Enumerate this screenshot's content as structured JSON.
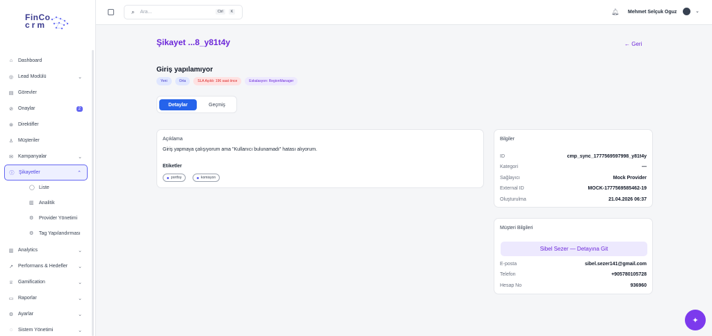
{
  "logo": {
    "line1": "FinCo",
    "line2": "crm"
  },
  "sidebar": {
    "items": [
      {
        "label": "Dashboard",
        "icon": "home-icon",
        "chevron": false
      },
      {
        "label": "Lead Modülü",
        "icon": "target-icon",
        "chevron": true
      },
      {
        "label": "Görevler",
        "icon": "clipboard-icon",
        "chevron": false
      },
      {
        "label": "Onaylar",
        "icon": "check-circle-icon",
        "badge": "2"
      },
      {
        "label": "Direktifler",
        "icon": "compass-icon",
        "chevron": false
      },
      {
        "label": "Müşteriler",
        "icon": "user-icon",
        "chevron": false
      },
      {
        "label": "Kampanyalar",
        "icon": "mail-icon",
        "chevron": true
      },
      {
        "label": "Şikayetler",
        "icon": "alert-circle-icon",
        "chevron": true,
        "active": true
      }
    ],
    "subitems": [
      {
        "label": "Liste",
        "icon": "circle-icon"
      },
      {
        "label": "Analitik",
        "icon": "bar-chart-icon"
      },
      {
        "label": "Provider Yönetimi",
        "icon": "settings-icon"
      },
      {
        "label": "Tag Yapılandırması",
        "icon": "settings-icon"
      }
    ],
    "items_bottom": [
      {
        "label": "Analytics",
        "icon": "bar-chart-icon"
      },
      {
        "label": "Performans & Hedefler",
        "icon": "trending-up-icon"
      },
      {
        "label": "Gamification",
        "icon": "trophy-icon"
      },
      {
        "label": "Raporlar",
        "icon": "file-icon"
      },
      {
        "label": "Ayarlar",
        "icon": "settings-icon"
      },
      {
        "label": "Sistem Yönetimi",
        "icon": "shield-icon"
      }
    ]
  },
  "topbar": {
    "search_placeholder": "Ara...",
    "kbd1": "Ctrl",
    "kbd2": "K",
    "user_name": "Mehmet Selçuk Oguz"
  },
  "page": {
    "title": "Şikayet ...8_y81t4y",
    "back": "← Geri",
    "subject": "Giriş yapılamıyor",
    "pills": [
      {
        "label": "Yeni",
        "bg": "#e0e7ff",
        "fg": "#4338ca"
      },
      {
        "label": "Orta",
        "bg": "#e0e7ff",
        "fg": "#4338ca"
      },
      {
        "label": "SLA Aşıldı: 196 saat önce",
        "bg": "#fee2e2",
        "fg": "#dc2626"
      },
      {
        "label": "Eskalasyon: RegionManager",
        "bg": "#ede9fe",
        "fg": "#6d28d9"
      }
    ],
    "tabs": {
      "active": "Detaylar",
      "other": "Geçmiş"
    }
  },
  "description_card": {
    "title": "Açıklama",
    "text": "Giriş yapmaya çalışıyorum ama \"Kullanıcı bulunamadı\" hatası alıyorum.",
    "tags_label": "Etiketler",
    "tags": [
      "portfoy",
      "komisyon"
    ]
  },
  "info_card": {
    "title": "Bilgiler",
    "rows": [
      {
        "k": "ID",
        "v": "cmp_sync_1777569597998_y81t4y"
      },
      {
        "k": "Kategori",
        "v": "—"
      },
      {
        "k": "Sağlayıcı",
        "v": "Mock Provider"
      },
      {
        "k": "External ID",
        "v": "MOCK-1777569585462-19"
      },
      {
        "k": "Oluşturulma",
        "v": "21.04.2026 06:37"
      }
    ]
  },
  "customer_card": {
    "title": "Müşteri Bilgileri",
    "button": "Sibel Sezer — Detayına Git",
    "rows": [
      {
        "k": "E-posta",
        "v": "sibel.sezer141@gmail.com"
      },
      {
        "k": "Telefon",
        "v": "+905780105728"
      },
      {
        "k": "Hesap No",
        "v": "936960"
      }
    ]
  },
  "colors": {
    "accent": "#6d28d9",
    "primary": "#2563eb",
    "fab": "#7c3aed"
  }
}
